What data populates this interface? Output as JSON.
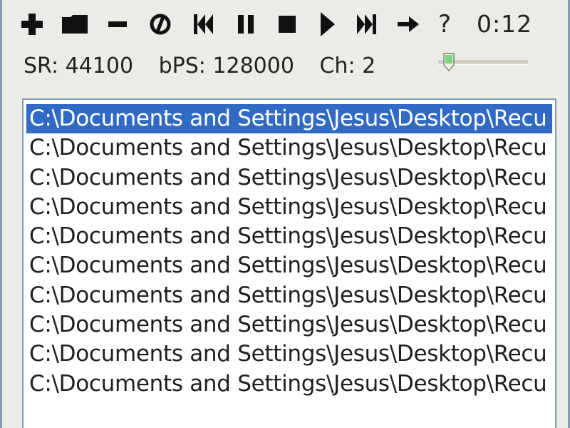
{
  "colors": {
    "selection": "#316ac5",
    "frame": "#7f9db9",
    "panel": "#ecebe6",
    "slider_thumb_fill": "#7fd27f"
  },
  "toolbar": {
    "buttons": [
      {
        "name": "add-icon",
        "icon": "plus"
      },
      {
        "name": "open-folder-icon",
        "icon": "folder"
      },
      {
        "name": "remove-icon",
        "icon": "minus"
      },
      {
        "name": "no-entry-icon",
        "icon": "circle-slash"
      },
      {
        "name": "previous-track-icon",
        "icon": "prev"
      },
      {
        "name": "pause-icon",
        "icon": "pause"
      },
      {
        "name": "stop-icon",
        "icon": "stop"
      },
      {
        "name": "play-icon",
        "icon": "play"
      },
      {
        "name": "next-track-icon",
        "icon": "next"
      },
      {
        "name": "arrow-right-icon",
        "icon": "arrow-right"
      }
    ],
    "help_label": "?",
    "time": "0:12"
  },
  "info": {
    "sample_rate": "SR: 44100",
    "bitrate": "bPS: 128000",
    "channels": "Ch: 2"
  },
  "volume": {
    "level_fraction": 0.12
  },
  "playlist": {
    "selected_index": 0,
    "items": [
      "C:\\Documents and Settings\\Jesus\\Desktop\\Recu",
      "C:\\Documents and Settings\\Jesus\\Desktop\\Recu",
      "C:\\Documents and Settings\\Jesus\\Desktop\\Recu",
      "C:\\Documents and Settings\\Jesus\\Desktop\\Recu",
      "C:\\Documents and Settings\\Jesus\\Desktop\\Recu",
      "C:\\Documents and Settings\\Jesus\\Desktop\\Recu",
      "C:\\Documents and Settings\\Jesus\\Desktop\\Recu",
      "C:\\Documents and Settings\\Jesus\\Desktop\\Recu",
      "C:\\Documents and Settings\\Jesus\\Desktop\\Recu",
      "C:\\Documents and Settings\\Jesus\\Desktop\\Recu"
    ]
  }
}
